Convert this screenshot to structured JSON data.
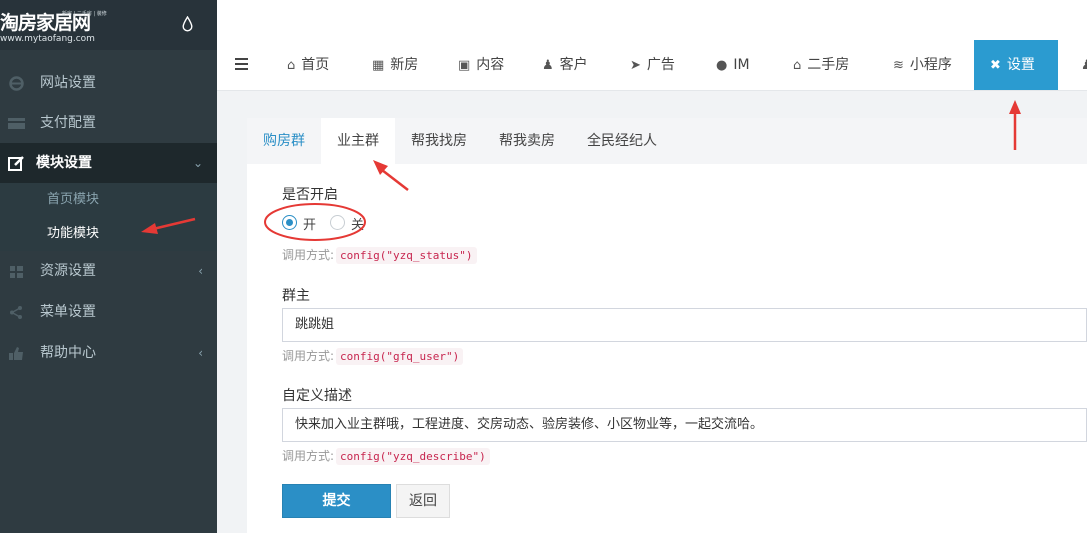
{
  "brand": {
    "name": "淘房家居网",
    "tagline": "新房 | 二手房 | 装修",
    "url": "www.mytaofang.com"
  },
  "sidebar": {
    "items": [
      {
        "label": "网站设置",
        "icon": "ie-icon"
      },
      {
        "label": "支付配置",
        "icon": "card-icon"
      },
      {
        "label": "模块设置",
        "icon": "edit-icon",
        "active": true
      },
      {
        "label": "资源设置",
        "icon": "grid-icon"
      },
      {
        "label": "菜单设置",
        "icon": "share-icon"
      },
      {
        "label": "帮助中心",
        "icon": "thumbs-up-icon"
      }
    ],
    "submenu": [
      {
        "label": "首页模块"
      },
      {
        "label": "功能模块",
        "active": true
      }
    ]
  },
  "topnav": {
    "tabs": [
      {
        "label": "首页",
        "icon": "home-icon"
      },
      {
        "label": "新房",
        "icon": "building-icon"
      },
      {
        "label": "内容",
        "icon": "content-icon"
      },
      {
        "label": "客户",
        "icon": "user-plus-icon"
      },
      {
        "label": "广告",
        "icon": "send-icon"
      },
      {
        "label": "IM",
        "icon": "chat-icon"
      },
      {
        "label": "二手房",
        "icon": "home-icon"
      },
      {
        "label": "小程序",
        "icon": "wifi-icon"
      },
      {
        "label": "设置",
        "icon": "settings-icon",
        "active": true
      }
    ]
  },
  "subtabs": [
    "购房群",
    "业主群",
    "帮我找房",
    "帮我卖房",
    "全民经纪人"
  ],
  "form": {
    "status": {
      "label": "是否开启",
      "options": [
        "开",
        "关"
      ],
      "selected": "开",
      "help_prefix": "调用方式:",
      "help_code": "config(\"yzq_status\")"
    },
    "owner": {
      "label": "群主",
      "value": "跳跳姐",
      "help_prefix": "调用方式:",
      "help_code": "config(\"gfq_user\")"
    },
    "describe": {
      "label": "自定义描述",
      "value": "快来加入业主群哦，工程进度、交房动态、验房装修、小区物业等，一起交流哈。",
      "help_prefix": "调用方式:",
      "help_code": "config(\"yzq_describe\")"
    },
    "submit_label": "提交",
    "back_label": "返回"
  },
  "colors": {
    "sidebar_bg": "#2f3b41",
    "accent": "#2b9bd0",
    "annotation": "#e53935"
  }
}
